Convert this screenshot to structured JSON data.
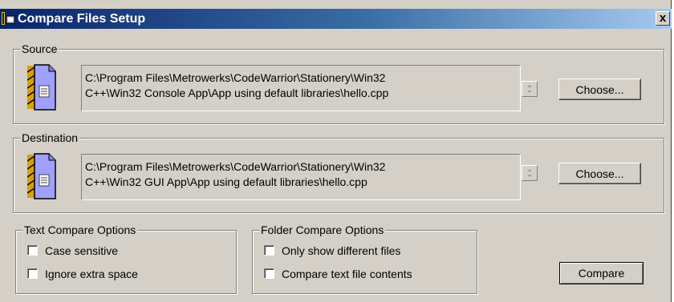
{
  "window": {
    "title": "Compare Files Setup",
    "close_glyph": "x"
  },
  "source": {
    "legend": "Source",
    "icon": "document-file-icon",
    "path_line1": "C:\\Program Files\\Metrowerks\\CodeWarrior\\Stationery\\Win32",
    "path_line2": "C++\\Win32 Console App\\App using default libraries\\hello.cpp",
    "choose_label": "Choose..."
  },
  "destination": {
    "legend": "Destination",
    "icon": "document-file-icon",
    "path_line1": "C:\\Program Files\\Metrowerks\\CodeWarrior\\Stationery\\Win32",
    "path_line2": "C++\\Win32 GUI App\\App using default libraries\\hello.cpp",
    "choose_label": "Choose..."
  },
  "text_options": {
    "legend": "Text Compare Options",
    "case_sensitive": {
      "label": "Case sensitive",
      "checked": false
    },
    "ignore_space": {
      "label": "Ignore extra space",
      "checked": false
    }
  },
  "folder_options": {
    "legend": "Folder Compare Options",
    "only_different": {
      "label": "Only show different files",
      "checked": false
    },
    "compare_contents": {
      "label": "Compare text file contents",
      "checked": false
    }
  },
  "compare_label": "Compare",
  "colors": {
    "face": "#d4d0c8",
    "title_start": "#0a246a",
    "title_end": "#a6caf0"
  }
}
